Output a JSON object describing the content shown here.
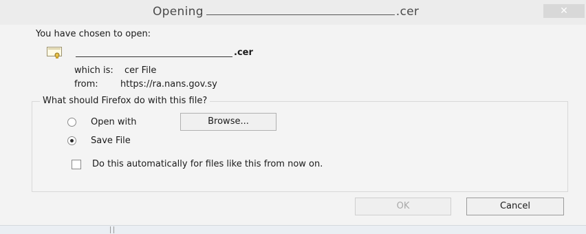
{
  "window": {
    "title_prefix": "Opening",
    "title_suffix": ".cer",
    "close_label": "✕"
  },
  "dialog": {
    "chosen_label": "You have chosen to open:",
    "file_ext": ".cer",
    "which_label": "which is:",
    "which_value": "cer File",
    "from_label": "from:",
    "from_value": "https://ra.nans.gov.sy"
  },
  "action_group": {
    "title": "What should Firefox do with this file?",
    "open_with_label": "Open with",
    "browse_label": "Browse...",
    "save_file_label": "Save File",
    "save_file_selected": true,
    "auto_label": "Do this automatically for files like this from now on.",
    "auto_checked": false
  },
  "buttons": {
    "ok_label": "OK",
    "cancel_label": "Cancel"
  }
}
